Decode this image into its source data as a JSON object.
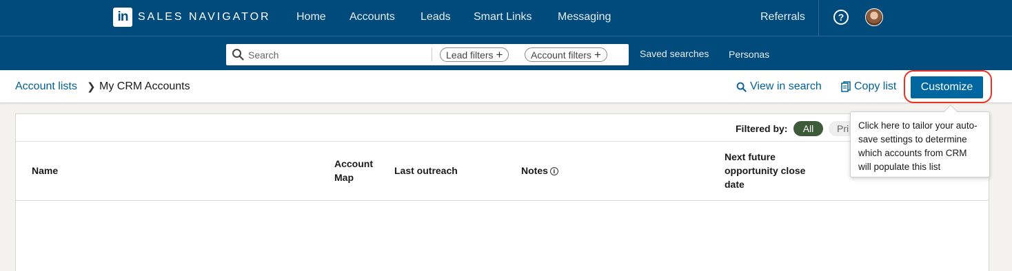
{
  "brand": {
    "logo": "in",
    "name": "SALES NAVIGATOR"
  },
  "topnav": {
    "items": [
      "Home",
      "Accounts",
      "Leads",
      "Smart Links",
      "Messaging"
    ],
    "referrals": "Referrals",
    "help_icon": "question-circle-icon",
    "avatar_icon": "user-avatar"
  },
  "searchbar": {
    "placeholder": "Search",
    "lead_filters": "Lead filters",
    "account_filters": "Account filters",
    "saved_searches": "Saved searches",
    "personas": "Personas"
  },
  "breadcrumb": {
    "parent": "Account lists",
    "current": "My CRM Accounts"
  },
  "actions": {
    "view_in_search": "View in search",
    "copy_list": "Copy list",
    "customize": "Customize"
  },
  "table": {
    "filtered_by": "Filtered by:",
    "filter_all": "All",
    "filter_other": "Pri",
    "columns": {
      "name": "Name",
      "account_map_1": "Account",
      "account_map_2": "Map",
      "last_outreach": "Last outreach",
      "notes": "Notes",
      "next_1": "Next future",
      "next_2": "opportunity close",
      "next_3": "date"
    }
  },
  "tooltip": {
    "text": "Click here to tailor your auto-save settings to determine which accounts from CRM will populate this list"
  },
  "colors": {
    "nav_bg": "#004b7c",
    "link": "#006097",
    "primary_button": "#00669f",
    "highlight_ring": "#e8321f",
    "filter_active": "#3d5b39"
  }
}
